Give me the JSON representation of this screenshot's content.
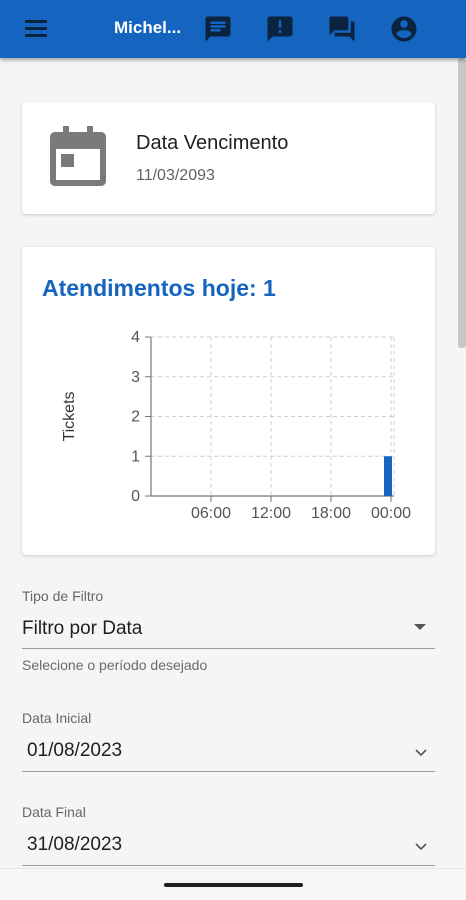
{
  "app_bar": {
    "title": "Michel...",
    "background": "#1565c0",
    "icons": [
      "menu-icon",
      "chat-icon",
      "report-icon",
      "forum-icon",
      "account-circle-icon"
    ]
  },
  "due_card": {
    "icon": "calendar-icon",
    "label": "Data Vencimento",
    "date": "11/03/2093"
  },
  "chart_card": {
    "title": "Atendimentos hoje: 1",
    "accent": "#1565c0"
  },
  "chart_data": {
    "type": "bar",
    "ylabel": "Tickets",
    "y_ticks": [
      "0",
      "1",
      "2",
      "3",
      "4"
    ],
    "ylim": [
      0,
      4
    ],
    "x_ticks": [
      "06:00",
      "12:00",
      "18:00",
      "00:00"
    ],
    "x_tick_hours": [
      6,
      12,
      18,
      24
    ],
    "xlim_hours": [
      0,
      24.3
    ],
    "grid": true,
    "bars": [
      {
        "hour": 23,
        "value": 1
      }
    ],
    "bar_color": "#1565c0"
  },
  "filter": {
    "label": "Tipo de Filtro",
    "value": "Filtro por Data",
    "helper": "Selecione o período desejado"
  },
  "start_date": {
    "label": "Data Inicial",
    "value": "01/08/2023"
  },
  "end_date": {
    "label": "Data Final",
    "value": "31/08/2023"
  }
}
